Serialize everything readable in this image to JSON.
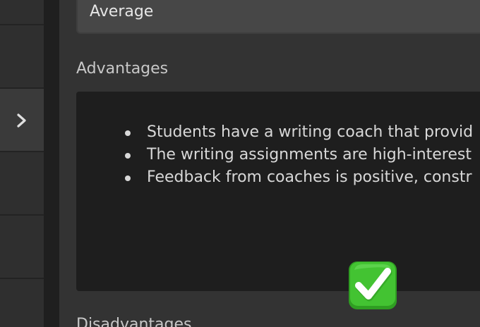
{
  "sidebar": {
    "expand_icon": "chevron-right-icon"
  },
  "select": {
    "value": "Average"
  },
  "advantages": {
    "label": "Advantages",
    "items": [
      "Students have a writing coach that provid",
      "The writing assignments are high-interest",
      "Feedback from coaches is positive, constr"
    ]
  },
  "disadvantages": {
    "label": "Disadvantages"
  },
  "emoji": {
    "icon": "check-mark-button-icon",
    "colors": {
      "box": "#3fbf2f",
      "mark": "#ffffff"
    }
  }
}
